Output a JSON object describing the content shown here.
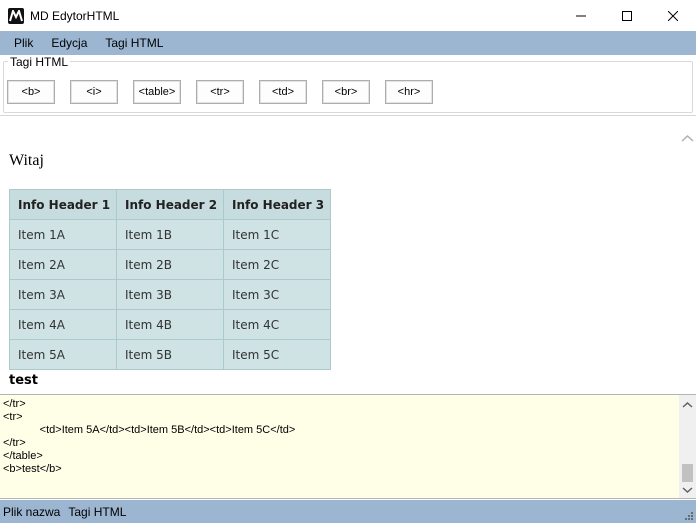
{
  "window": {
    "title": "MD EdytorHTML"
  },
  "menu": {
    "items": [
      "Plik",
      "Edycja",
      "Tagi HTML"
    ]
  },
  "toolbar": {
    "group_label": "Tagi HTML",
    "buttons": [
      "<b>",
      "<i>",
      "<table>",
      "<tr>",
      "<td>",
      "<br>",
      "<hr>"
    ]
  },
  "preview": {
    "heading": "Witaj",
    "table": {
      "headers": [
        "Info Header 1",
        "Info Header 2",
        "Info Header 3"
      ],
      "rows": [
        [
          "Item 1A",
          "Item 1B",
          "Item 1C"
        ],
        [
          "Item 2A",
          "Item 2B",
          "Item 2C"
        ],
        [
          "Item 3A",
          "Item 3B",
          "Item 3C"
        ],
        [
          "Item 4A",
          "Item 4B",
          "Item 4C"
        ],
        [
          "Item 5A",
          "Item 5B",
          "Item 5C"
        ]
      ]
    },
    "bold_text": "test"
  },
  "editor": {
    "lines": [
      "</tr>",
      "<tr>",
      "            <td>Item 5A</td><td>Item 5B</td><td>Item 5C</td>",
      "</tr>",
      "</table>",
      "<b>test</b>"
    ]
  },
  "status": {
    "items": [
      "Plik nazwa",
      "Tagi HTML"
    ]
  },
  "colors": {
    "accent_bar": "#9cb6d2",
    "editor_bg": "#ffffe8",
    "table_bg": "#cfe2e4"
  }
}
